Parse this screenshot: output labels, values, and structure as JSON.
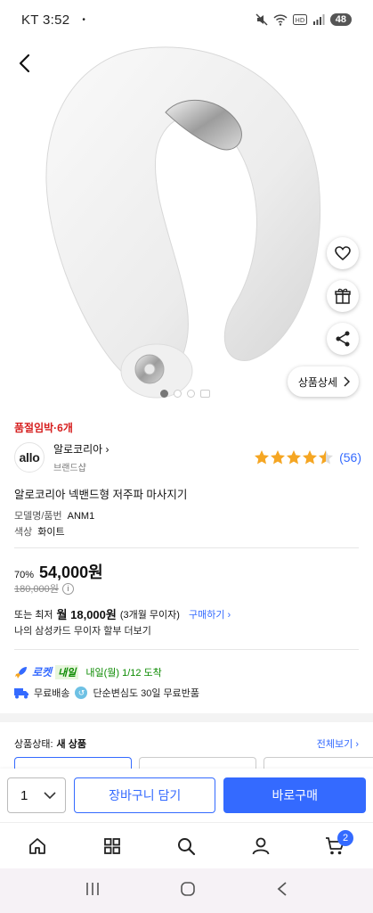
{
  "status_bar": {
    "carrier_time": "KT 3:52",
    "dot": "•",
    "battery": "48"
  },
  "product_image": {
    "page_indicator_count": 3
  },
  "side_actions": {
    "detail_label": "상품상세"
  },
  "best_badge": "품절임박·6개",
  "brand": {
    "logo_text": "allo",
    "name": "알로코리아",
    "shop_label": "브랜드샵"
  },
  "rating": {
    "stars": 4.5,
    "count": "(56)"
  },
  "product": {
    "title": "알로코리아 넥밴드형 저주파 마사지기",
    "model_label": "모델명/품번",
    "model_value": "ANM1",
    "color_label": "색상",
    "color_value": "화이트"
  },
  "price": {
    "discount": "70%",
    "sale": "54,000원",
    "original": "180,000원",
    "installment_prefix": "또는 최저",
    "installment_amount": "월 18,000원",
    "installment_terms": "(3개월 무이자)",
    "installment_buy": "구매하기",
    "card_notice": "나의 삼성카드 무이자 할부 더보기"
  },
  "delivery": {
    "rocket_label": "로켓",
    "tomorrow_label": "내일",
    "date": "내일(월) 1/12 도착",
    "free_shipping": "무료배송",
    "free_return": "단순변심도 30일 무료반품"
  },
  "condition": {
    "label": "상품상태:",
    "value": "새 상품",
    "see_all": "전체보기"
  },
  "action_bar": {
    "quantity": "1",
    "cart": "장바구니 담기",
    "buy": "바로구매"
  },
  "bottom_nav": {
    "cart_count": "2"
  },
  "colors": {
    "accent": "#346aff",
    "best": "#d61f1f",
    "star": "#f5a623",
    "delivery_green": "#0b8a00"
  }
}
